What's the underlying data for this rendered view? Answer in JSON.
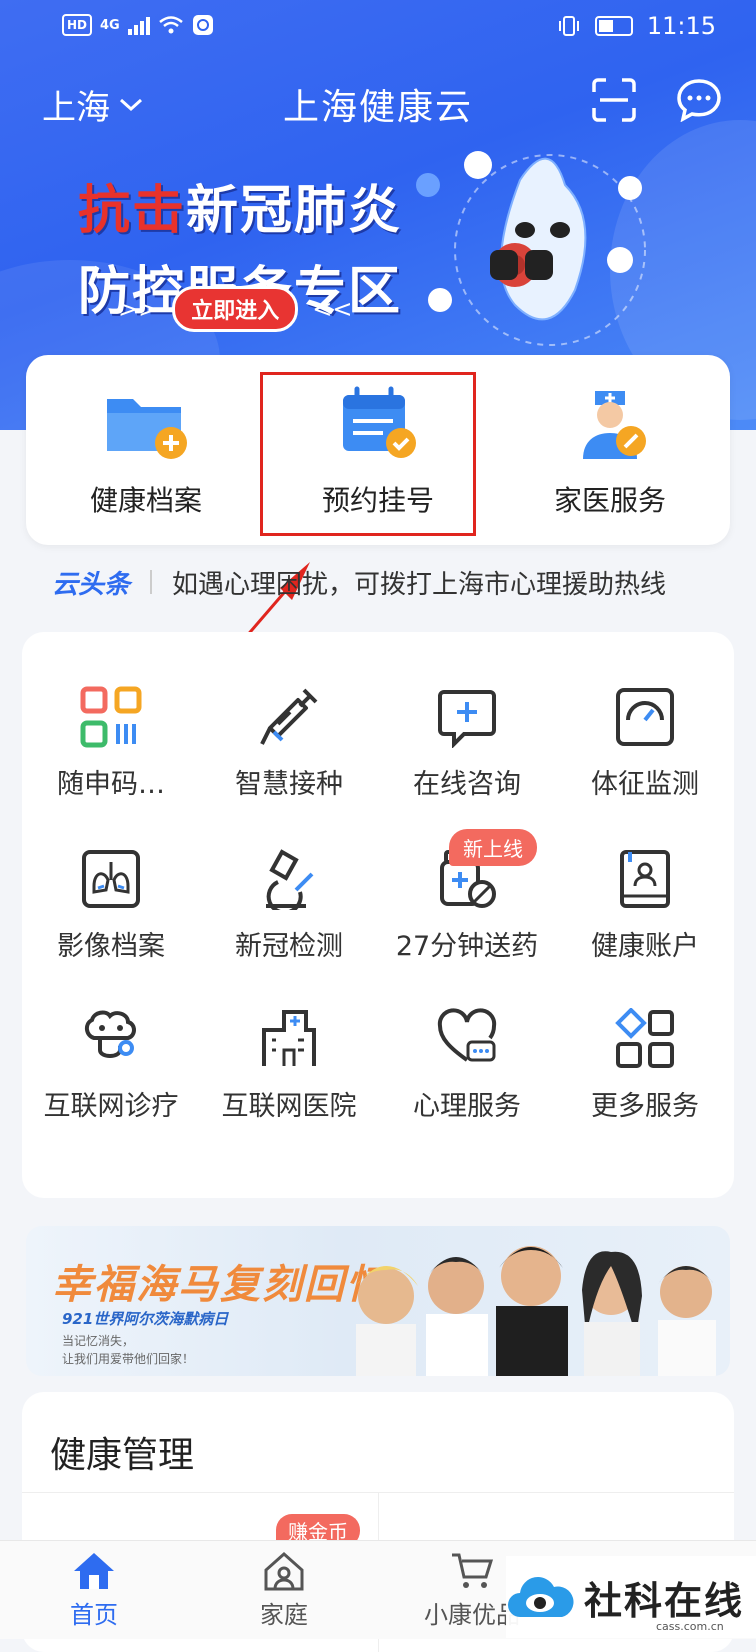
{
  "status_bar": {
    "hd": "HD",
    "network": "4G",
    "time": "11:15"
  },
  "header": {
    "city": "上海",
    "title": "上海健康云"
  },
  "banner": {
    "line1_red": "抗击",
    "line1_rest": "新冠肺炎",
    "line2": "防控服务专区",
    "arrows_left": ">>",
    "arrows_right": "<<",
    "button": "立即进入"
  },
  "quick_actions": [
    {
      "label": "健康档案",
      "icon": "folder-plus-icon"
    },
    {
      "label": "预约挂号",
      "icon": "calendar-check-icon",
      "highlighted": true
    },
    {
      "label": "家医服务",
      "icon": "doctor-icon"
    }
  ],
  "news": {
    "tag": "云头条",
    "text": "如遇心理困扰，可拨打上海市心理援助热线"
  },
  "services": [
    {
      "label": "随申码…",
      "icon": "qr-code-icon"
    },
    {
      "label": "智慧接种",
      "icon": "syringe-icon"
    },
    {
      "label": "在线咨询",
      "icon": "chat-plus-icon"
    },
    {
      "label": "体征监测",
      "icon": "gauge-icon"
    },
    {
      "label": "影像档案",
      "icon": "lungs-icon"
    },
    {
      "label": "新冠检测",
      "icon": "microscope-icon"
    },
    {
      "label": "27分钟送药",
      "icon": "medicine-bottle-icon",
      "badge": "新上线"
    },
    {
      "label": "健康账户",
      "icon": "account-book-icon"
    },
    {
      "label": "互联网诊疗",
      "icon": "stethoscope-brain-icon"
    },
    {
      "label": "互联网医院",
      "icon": "hospital-icon"
    },
    {
      "label": "心理服务",
      "icon": "heart-chat-icon"
    },
    {
      "label": "更多服务",
      "icon": "apps-grid-icon"
    }
  ],
  "ad": {
    "title": "幸福海马复刻回忆",
    "subtitle": "921世界阿尔茨海默病日",
    "line1": "当记忆消失，",
    "line2": "让我们用爱带他们回家！"
  },
  "health_management": {
    "title": "健康管理",
    "coin_badge": "赚金币"
  },
  "tabbar": [
    {
      "label": "首页",
      "active": true
    },
    {
      "label": "家庭",
      "active": false
    },
    {
      "label": "小康优品",
      "active": false
    }
  ],
  "watermark": {
    "text": "社科在线",
    "url": "cass.com.cn"
  },
  "colors": {
    "brand_blue": "#2e6cf0",
    "highlight_red": "#e0251e",
    "badge_red": "#f36a5f"
  }
}
